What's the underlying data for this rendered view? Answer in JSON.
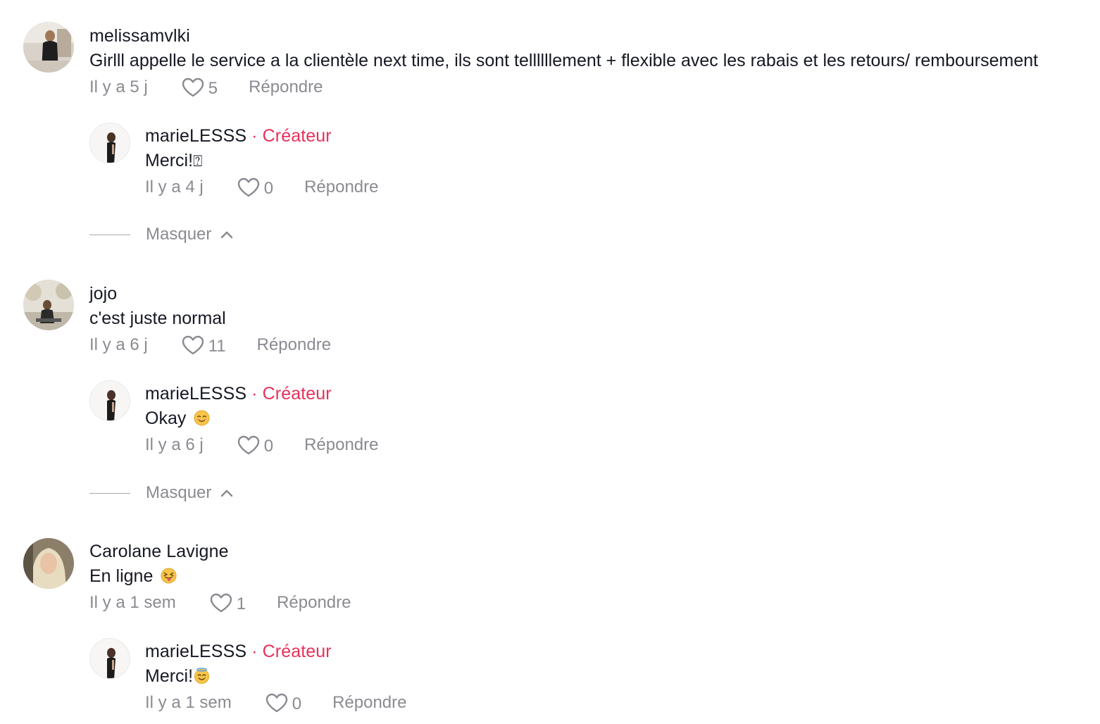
{
  "threads": [
    {
      "user": "melissamvlki",
      "text": "Girlll appelle le service a la clientèle next time, ils sont tellllllement + flexible avec les rabais et les retours/ remboursement",
      "time": "Il y a 5 j",
      "likes": "5",
      "reply_label": "Répondre",
      "reply": {
        "user": "marieLESSS",
        "badge": "· Créateur",
        "text": "Merci!",
        "text_suffix": "⍰",
        "time": "Il y a 4 j",
        "likes": "0",
        "reply_label": "Répondre"
      },
      "hide_label": "Masquer"
    },
    {
      "user": "jojo",
      "text": "c'est juste normal",
      "time": "Il y a 6 j",
      "likes": "11",
      "reply_label": "Répondre",
      "reply": {
        "user": "marieLESSS",
        "badge": "· Créateur",
        "text": "Okay",
        "emoji": "relieved-smile-emoji",
        "time": "Il y a 6 j",
        "likes": "0",
        "reply_label": "Répondre"
      },
      "hide_label": "Masquer"
    },
    {
      "user": "Carolane Lavigne",
      "text": "En ligne",
      "emoji": "tongue-out-emoji",
      "time": "Il y a 1 sem",
      "likes": "1",
      "reply_label": "Répondre",
      "reply": {
        "user": "marieLESSS",
        "badge": "· Créateur",
        "text": "Merci!",
        "emoji": "halo-smile-emoji",
        "time": "Il y a 1 sem",
        "likes": "0",
        "reply_label": "Répondre"
      }
    }
  ],
  "colors": {
    "creator_badge": "#e8305a",
    "meta_gray": "#8a8b91",
    "text": "#161823"
  }
}
